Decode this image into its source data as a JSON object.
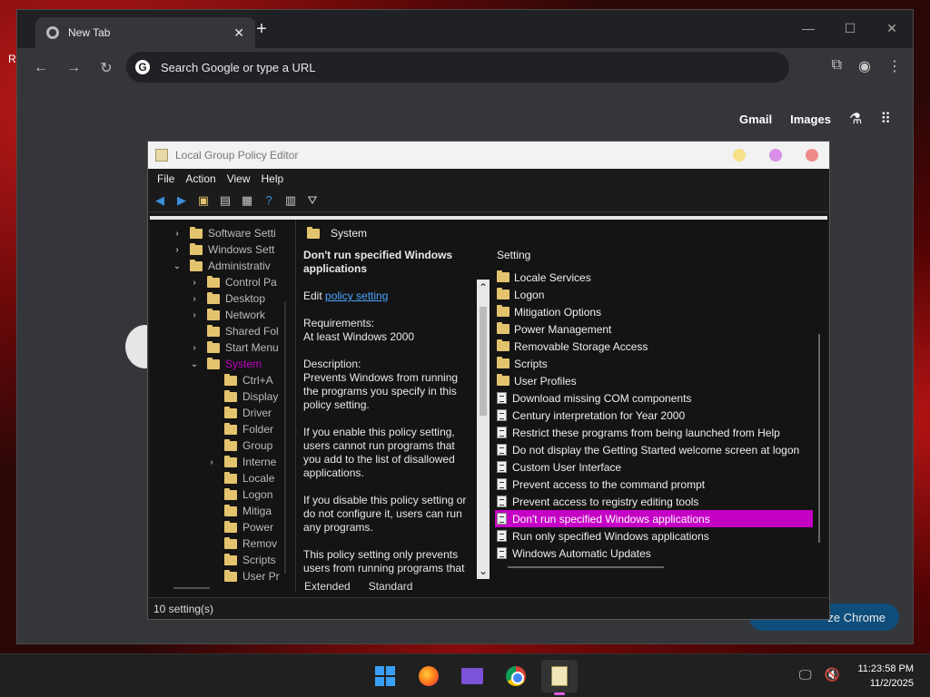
{
  "desktop": {
    "edge_text": "R"
  },
  "chrome": {
    "tab_title": "New Tab",
    "tab_close": "✕",
    "new_tab": "+",
    "controls": {
      "minimize": "—",
      "maximize": "☐",
      "close": "✕"
    },
    "omnibox_placeholder": "Search Google or type a URL",
    "google_links": {
      "gmail": "Gmail",
      "images": "Images"
    },
    "customize_label": "ze Chrome"
  },
  "gpe": {
    "title": "Local Group Policy Editor",
    "menu": [
      "File",
      "Action",
      "View",
      "Help"
    ],
    "tree": [
      {
        "label": "Software Setti",
        "chev": "›",
        "indent": 1
      },
      {
        "label": "Windows Sett",
        "chev": "›",
        "indent": 1
      },
      {
        "label": "Administrativ",
        "chev": "⌄",
        "indent": 1
      },
      {
        "label": "Control Pa",
        "chev": "›",
        "indent": 2
      },
      {
        "label": "Desktop",
        "chev": "›",
        "indent": 2
      },
      {
        "label": "Network",
        "chev": "›",
        "indent": 2
      },
      {
        "label": "Shared Fol",
        "chev": "",
        "indent": 2
      },
      {
        "label": "Start Menu",
        "chev": "›",
        "indent": 2
      },
      {
        "label": "System",
        "chev": "⌄",
        "indent": 2,
        "selected": true
      },
      {
        "label": "Ctrl+A",
        "chev": "",
        "indent": 3
      },
      {
        "label": "Display",
        "chev": "",
        "indent": 3
      },
      {
        "label": "Driver",
        "chev": "",
        "indent": 3
      },
      {
        "label": "Folder",
        "chev": "",
        "indent": 3
      },
      {
        "label": "Group",
        "chev": "",
        "indent": 3
      },
      {
        "label": "Interne",
        "chev": "›",
        "indent": 3
      },
      {
        "label": "Locale",
        "chev": "",
        "indent": 3
      },
      {
        "label": "Logon",
        "chev": "",
        "indent": 3
      },
      {
        "label": "Mitiga",
        "chev": "",
        "indent": 3
      },
      {
        "label": "Power",
        "chev": "",
        "indent": 3
      },
      {
        "label": "Remov",
        "chev": "",
        "indent": 3
      },
      {
        "label": "Scripts",
        "chev": "",
        "indent": 3
      },
      {
        "label": "User Pr",
        "chev": "",
        "indent": 3
      }
    ],
    "desc": {
      "header": "System",
      "policy_title": "Don't run specified Windows applications",
      "edit_prefix": "Edit ",
      "edit_link": "policy setting ",
      "requirements_label": "Requirements:",
      "requirements_value": "At least Windows 2000",
      "description_label": "Description:",
      "p1": "Prevents Windows from running the programs you specify in this policy setting.",
      "p2": "If you enable this policy setting, users cannot run programs that you add to the list of disallowed applications.",
      "p3": "If you disable this policy setting or do not configure it, users can run any programs.",
      "p4": "This policy setting only prevents users from running programs that"
    },
    "list_header": "Setting",
    "settings": [
      {
        "label": "Locale Services",
        "type": "folder"
      },
      {
        "label": "Logon",
        "type": "folder"
      },
      {
        "label": "Mitigation Options",
        "type": "folder"
      },
      {
        "label": "Power Management",
        "type": "folder"
      },
      {
        "label": "Removable Storage Access",
        "type": "folder"
      },
      {
        "label": "Scripts",
        "type": "folder"
      },
      {
        "label": "User Profiles",
        "type": "folder"
      },
      {
        "label": "Download missing COM components",
        "type": "setting"
      },
      {
        "label": "Century interpretation for Year 2000",
        "type": "setting"
      },
      {
        "label": "Restrict these programs from being launched from Help",
        "type": "setting"
      },
      {
        "label": "Do not display the Getting Started welcome screen at logon",
        "type": "setting"
      },
      {
        "label": "Custom User Interface",
        "type": "setting"
      },
      {
        "label": "Prevent access to the command prompt",
        "type": "setting"
      },
      {
        "label": "Prevent access to registry editing tools",
        "type": "setting"
      },
      {
        "label": "Don't run specified Windows applications",
        "type": "setting",
        "selected": true
      },
      {
        "label": "Run only specified Windows applications",
        "type": "setting"
      },
      {
        "label": "Windows Automatic Updates",
        "type": "setting"
      }
    ],
    "view_tabs": {
      "extended": "Extended",
      "standard": "Standard"
    },
    "status": "10 setting(s)"
  },
  "taskbar": {
    "time": "11:23:58 PM",
    "date": "11/2/2025"
  },
  "colors": {
    "accent_selection": "#c400c4",
    "tree_selected": "#c200c2",
    "link": "#4aa3ff"
  }
}
